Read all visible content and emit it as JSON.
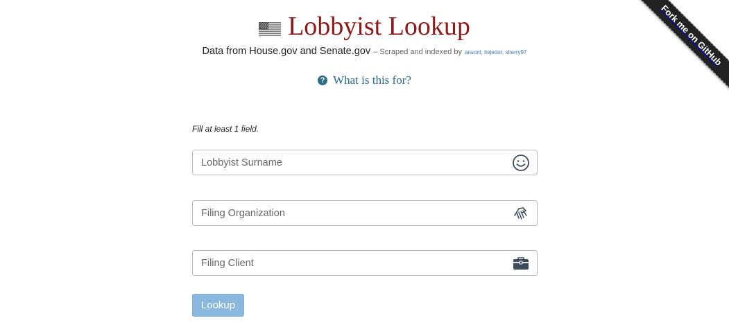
{
  "header": {
    "title": "Lobbyist Lookup",
    "subtitle_main": "Data from House.gov and Senate.gov",
    "subtitle_small": "– Scraped and indexed by",
    "authors": [
      "ansonl",
      "itejedor",
      "sherry97"
    ],
    "what_link": "What is this for?"
  },
  "form": {
    "hint": "Fill at least 1 field.",
    "fields": [
      {
        "placeholder": "Lobbyist Surname",
        "value": "",
        "icon": "smiley-face-icon"
      },
      {
        "placeholder": "Filing Organization",
        "value": "",
        "icon": "handshake-icon"
      },
      {
        "placeholder": "Filing Client",
        "value": "",
        "icon": "briefcase-icon"
      }
    ],
    "submit_label": "Lookup"
  },
  "ribbon": {
    "label": "Fork me on GitHub"
  },
  "colors": {
    "title": "#8b1a1a",
    "link": "#2a6b86",
    "button": "#8ab8df",
    "ribbon": "#222222"
  }
}
